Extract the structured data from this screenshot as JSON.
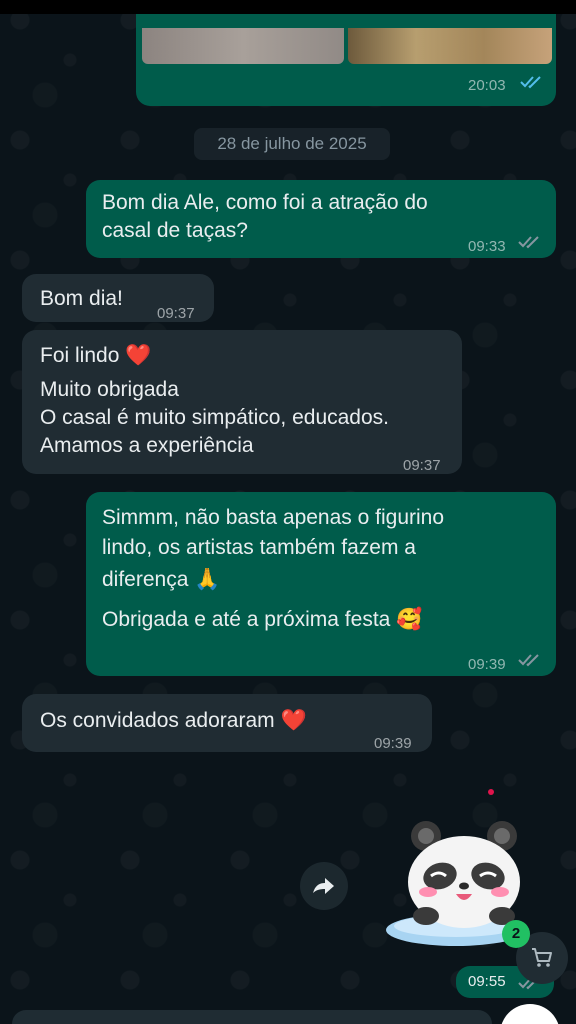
{
  "chat": {
    "date_separator": "28 de julho de 2025",
    "messages": [
      {
        "id": "m0",
        "direction": "out",
        "type": "image",
        "time": "20:03",
        "status": "read"
      },
      {
        "id": "m1",
        "direction": "out",
        "lines": [
          "Bom dia Ale, como foi a atração do",
          "casal de taças?"
        ],
        "time": "09:33",
        "status": "delivered"
      },
      {
        "id": "m2",
        "direction": "in",
        "lines": [
          "Bom dia!"
        ],
        "time": "09:37"
      },
      {
        "id": "m3",
        "direction": "in",
        "lines": [
          "Foi lindo ❤️",
          "Muito obrigada",
          "O casal é muito simpático, educados.",
          "Amamos a experiência"
        ],
        "time": "09:37"
      },
      {
        "id": "m4",
        "direction": "out",
        "lines": [
          "Simmm, não basta apenas o figurino",
          "lindo, os artistas também fazem a",
          "diferença 🙏",
          "Obrigada e até a próxima festa 🥰"
        ],
        "time": "09:39",
        "status": "delivered"
      },
      {
        "id": "m5",
        "direction": "in",
        "lines": [
          "Os convidados adoraram ❤️"
        ],
        "time": "09:39"
      },
      {
        "id": "m6",
        "direction": "out",
        "type": "sticker",
        "sticker": "panda-blushing-pillow",
        "time": "09:55",
        "status": "delivered"
      }
    ]
  },
  "actions": {
    "forward_icon": "forward-icon",
    "cart_icon": "cart-icon",
    "cart_badge": "2"
  },
  "colors": {
    "background": "#0b141a",
    "incoming_bubble": "#202c33",
    "outgoing_bubble": "#005c4b",
    "read_check": "#53bdeb",
    "delivered_check": "#8696a0",
    "badge": "#21c063"
  }
}
